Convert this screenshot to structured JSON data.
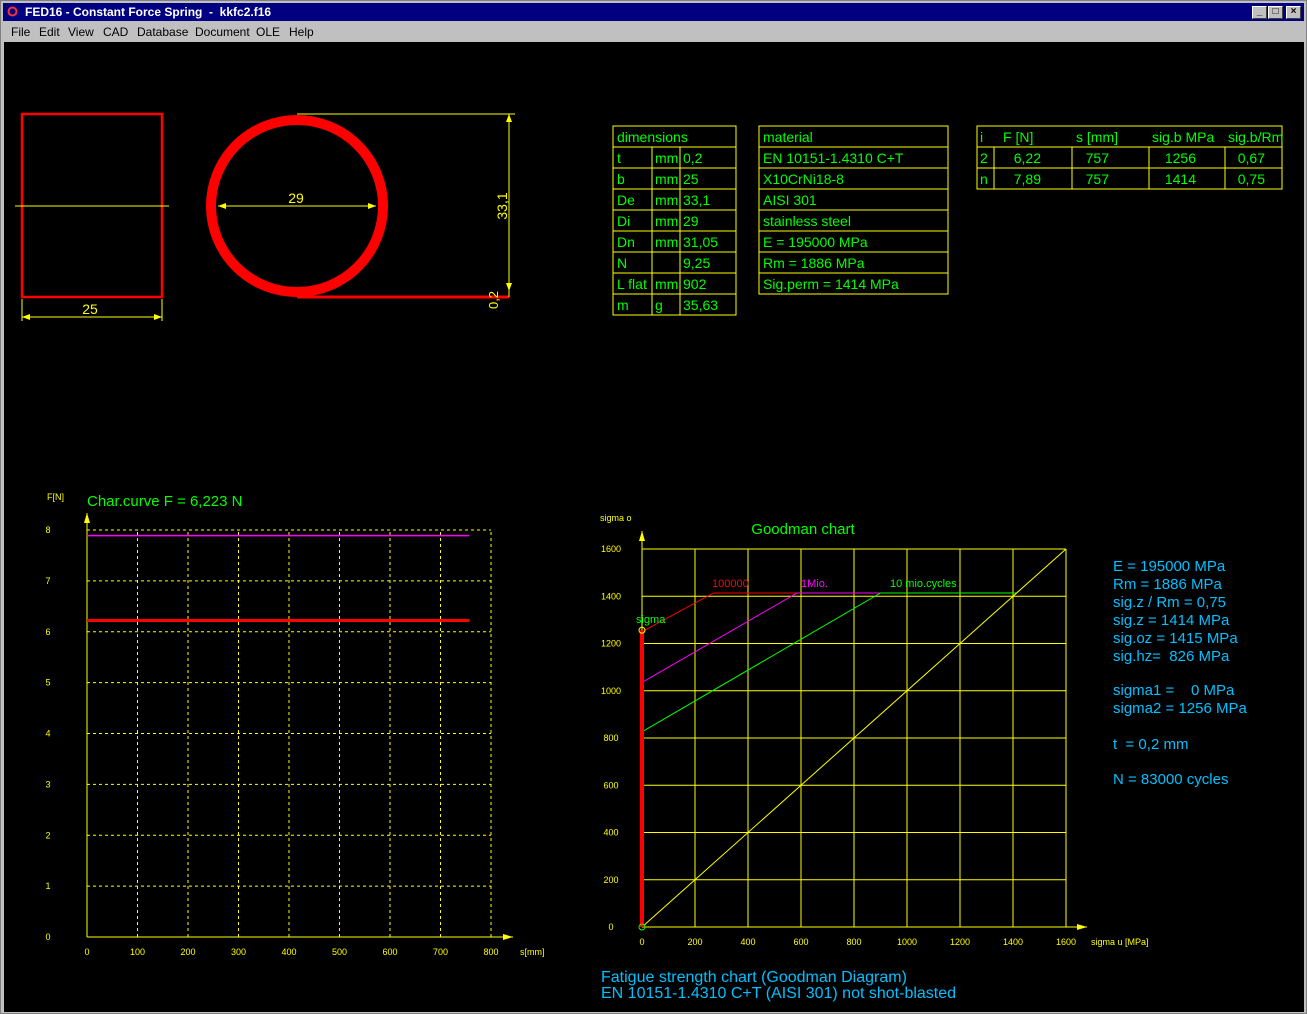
{
  "window": {
    "title": "FED16 - Constant Force Spring  -  kkfc2.f16",
    "menu": [
      "File",
      "Edit",
      "View",
      "CAD",
      "Database",
      "Document",
      "OLE",
      "Help"
    ],
    "buttons": {
      "minimize": "_",
      "maximize": "□",
      "close": "×"
    }
  },
  "colors": {
    "background": "#000000",
    "spring": "#ff0000",
    "tables": "#ffff00",
    "values": "#00ff00",
    "info": "#00c0ff",
    "magenta": "#ff00ff"
  },
  "drawing": {
    "width_label": "25",
    "diameter_label": "29",
    "outer_diameter_label": "33,1",
    "thickness_label": "0,2"
  },
  "dimensions_table": {
    "header": "dimensions",
    "rows": [
      {
        "name": "t",
        "unit": "mm",
        "value": "0,2"
      },
      {
        "name": "b",
        "unit": "mm",
        "value": "25"
      },
      {
        "name": "De",
        "unit": "mm",
        "value": "33,1"
      },
      {
        "name": "Di",
        "unit": "mm",
        "value": "29"
      },
      {
        "name": "Dn",
        "unit": "mm",
        "value": "31,05"
      },
      {
        "name": "N",
        "unit": "",
        "value": "9,25"
      },
      {
        "name": "L flat",
        "unit": "mm",
        "value": "902"
      },
      {
        "name": "m",
        "unit": "g",
        "value": "35,63"
      }
    ]
  },
  "material_table": {
    "header": "material",
    "rows": [
      "EN 10151-1.4310 C+T",
      "X10CrNi18-8",
      "AISI 301",
      "stainless steel",
      "E = 195000 MPa",
      "Rm = 1886 MPa",
      "Sig.perm = 1414 MPa"
    ]
  },
  "force_table": {
    "headers": [
      "i",
      "F [N]",
      "s [mm]",
      "sig.b MPa",
      "sig.b/Rm"
    ],
    "rows": [
      [
        "2",
        "6,22",
        "757",
        "1256",
        "0,67"
      ],
      [
        "n",
        "7,89",
        "757",
        "1414",
        "0,75"
      ]
    ]
  },
  "char_curve": {
    "title": "Char.curve F = 6,223 N",
    "ylabel": "F[N]",
    "xlabel": "s[mm]",
    "x_ticks": [
      "0",
      "100",
      "200",
      "300",
      "400",
      "500",
      "600",
      "700",
      "800"
    ],
    "y_ticks": [
      "0",
      "1",
      "2",
      "3",
      "4",
      "5",
      "6",
      "7",
      "8"
    ]
  },
  "goodman": {
    "title": "Goodman chart",
    "ylabel": "sigma o",
    "xlabel": "sigma u [MPa]",
    "ticks": [
      "0",
      "200",
      "400",
      "600",
      "800",
      "1000",
      "1200",
      "1400",
      "1600"
    ],
    "labels": {
      "c1": "100000",
      "c2": "1Mio.",
      "c3": "10 mio.cycles",
      "sigma": "sigma"
    },
    "caption1": "Fatigue strength chart (Goodman Diagram)",
    "caption2": "EN 10151-1.4310 C+T (AISI 301) not shot-blasted"
  },
  "chart_data": [
    {
      "type": "line",
      "title": "Char.curve F = 6,223 N",
      "xlabel": "s[mm]",
      "ylabel": "F[N]",
      "xlim": [
        0,
        800
      ],
      "ylim": [
        0,
        8
      ],
      "grid": true,
      "series": [
        {
          "color": "#ff0000",
          "x": [
            0,
            757
          ],
          "y": [
            6.22,
            6.22
          ]
        },
        {
          "color": "#ff00ff",
          "x": [
            0,
            757
          ],
          "y": [
            7.89,
            7.89
          ]
        }
      ]
    },
    {
      "type": "line",
      "title": "Goodman chart",
      "xlabel": "sigma u [MPa]",
      "ylabel": "sigma o",
      "xlim": [
        0,
        1600
      ],
      "ylim": [
        0,
        1600
      ],
      "grid": true,
      "series": [
        {
          "name": "100000",
          "color": "#ff0000",
          "x": [
            0,
            270,
            1414
          ],
          "y": [
            1250,
            1414,
            1414
          ]
        },
        {
          "name": "1Mio.",
          "color": "#ff00ff",
          "x": [
            0,
            585,
            1414
          ],
          "y": [
            1035,
            1414,
            1414
          ]
        },
        {
          "name": "10 mio.cycles",
          "color": "#00ff00",
          "x": [
            0,
            900,
            1414
          ],
          "y": [
            826,
            1414,
            1414
          ]
        },
        {
          "color": "#ffff00",
          "x": [
            0,
            1600
          ],
          "y": [
            0,
            1600
          ]
        },
        {
          "name": "sigma",
          "color": "#ff0000",
          "x": [
            0,
            0
          ],
          "y": [
            0,
            1256
          ]
        }
      ]
    }
  ],
  "info": [
    "E = 195000 MPa",
    "Rm = 1886 MPa",
    "sig.z / Rm = 0,75",
    "sig.z = 1414 MPa",
    "sig.oz = 1415 MPa",
    "sig.hz=  826 MPa",
    "sigma1 =    0 MPa",
    "sigma2 = 1256 MPa",
    "t  = 0,2 mm",
    "N = 83000 cycles"
  ]
}
